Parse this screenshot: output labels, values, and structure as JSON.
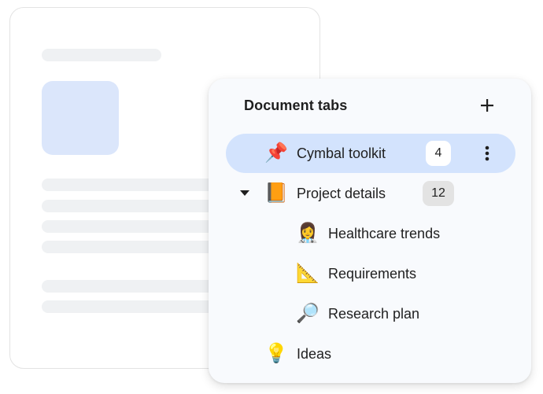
{
  "panel": {
    "title": "Document tabs",
    "add_icon": "plus-icon"
  },
  "tabs": [
    {
      "label": "Cymbal toolkit",
      "emoji": "📌",
      "icon": "pushpin-icon",
      "count": "4",
      "selected": true,
      "level": 0
    },
    {
      "label": "Project details",
      "emoji": "📙",
      "icon": "orange-book-icon",
      "count": "12",
      "expanded": true,
      "level": 0
    },
    {
      "label": "Healthcare trends",
      "emoji": "👩‍⚕️",
      "icon": "health-worker-icon",
      "level": 1
    },
    {
      "label": "Requirements",
      "emoji": "📐",
      "icon": "triangular-ruler-icon",
      "level": 1
    },
    {
      "label": "Research plan",
      "emoji": "🔎",
      "icon": "magnifying-glass-icon",
      "level": 1
    },
    {
      "label": "Ideas",
      "emoji": "💡",
      "icon": "light-bulb-icon",
      "level": 0
    }
  ],
  "colors": {
    "selected_row": "#d3e3fd",
    "panel_background": "#f8fafd",
    "doc_placeholder": "#eff1f3",
    "doc_image_placeholder": "#dbe6fb",
    "text": "#1f1f1f"
  }
}
